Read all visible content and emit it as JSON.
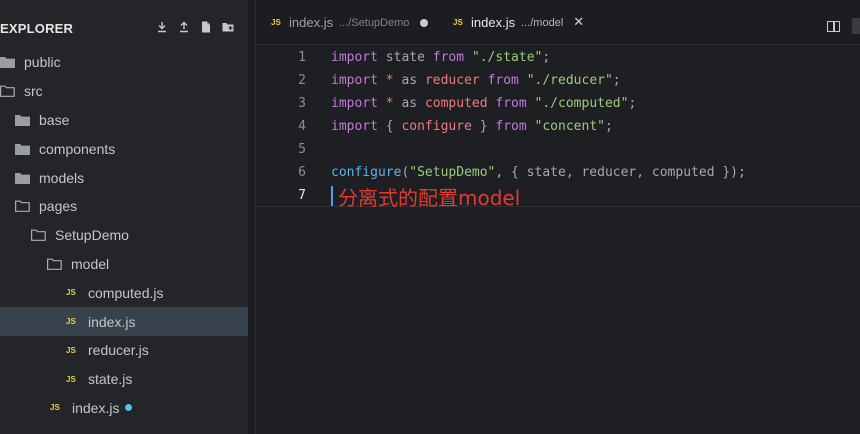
{
  "sidebar": {
    "title": "EXPLORER",
    "actions": [
      "download-icon",
      "upload-icon",
      "new-file-icon",
      "new-folder-icon"
    ],
    "tree": [
      {
        "label": "public",
        "type": "folder",
        "depth": 0
      },
      {
        "label": "src",
        "type": "folder-open",
        "depth": 0
      },
      {
        "label": "base",
        "type": "folder",
        "depth": 1
      },
      {
        "label": "components",
        "type": "folder",
        "depth": 1
      },
      {
        "label": "models",
        "type": "folder",
        "depth": 1
      },
      {
        "label": "pages",
        "type": "folder-open",
        "depth": 1
      },
      {
        "label": "SetupDemo",
        "type": "folder-open",
        "depth": 2
      },
      {
        "label": "model",
        "type": "folder-open",
        "depth": 3
      },
      {
        "label": "computed.js",
        "type": "js",
        "depth": 4
      },
      {
        "label": "index.js",
        "type": "js",
        "depth": 4,
        "selected": true
      },
      {
        "label": "reducer.js",
        "type": "js",
        "depth": 4
      },
      {
        "label": "state.js",
        "type": "js",
        "depth": 4
      },
      {
        "label": "index.js",
        "type": "js",
        "depth": 3,
        "modified": true
      }
    ]
  },
  "tabs": [
    {
      "badge": "JS",
      "name": "index.js",
      "path": ".../SetupDemo",
      "modified": true,
      "active": false
    },
    {
      "badge": "JS",
      "name": "index.js",
      "path": ".../model",
      "modified": false,
      "active": true
    }
  ],
  "editor": {
    "lines": [
      {
        "n": "1",
        "tokens": [
          [
            "kw",
            "import"
          ],
          [
            "id",
            " state "
          ],
          [
            "kw",
            "from"
          ],
          [
            "id",
            " "
          ],
          [
            "str",
            "\"./state\""
          ],
          [
            "punc",
            ";"
          ]
        ]
      },
      {
        "n": "2",
        "tokens": [
          [
            "kw",
            "import"
          ],
          [
            "id",
            " "
          ],
          [
            "ident",
            "*"
          ],
          [
            "id",
            " as "
          ],
          [
            "ident",
            "reducer"
          ],
          [
            "id",
            " "
          ],
          [
            "kw",
            "from"
          ],
          [
            "id",
            " "
          ],
          [
            "str",
            "\"./reducer\""
          ],
          [
            "punc",
            ";"
          ]
        ]
      },
      {
        "n": "3",
        "tokens": [
          [
            "kw",
            "import"
          ],
          [
            "id",
            " "
          ],
          [
            "ident",
            "*"
          ],
          [
            "id",
            " as "
          ],
          [
            "ident",
            "computed"
          ],
          [
            "id",
            " "
          ],
          [
            "kw",
            "from"
          ],
          [
            "id",
            " "
          ],
          [
            "str",
            "\"./computed\""
          ],
          [
            "punc",
            ";"
          ]
        ]
      },
      {
        "n": "4",
        "tokens": [
          [
            "kw",
            "import"
          ],
          [
            "id",
            " { "
          ],
          [
            "ident",
            "configure"
          ],
          [
            "id",
            " } "
          ],
          [
            "kw",
            "from"
          ],
          [
            "id",
            " "
          ],
          [
            "str",
            "\"concent\""
          ],
          [
            "punc",
            ";"
          ]
        ]
      },
      {
        "n": "5",
        "tokens": []
      },
      {
        "n": "6",
        "tokens": [
          [
            "fn",
            "configure"
          ],
          [
            "punc",
            "("
          ],
          [
            "str",
            "\"SetupDemo\""
          ],
          [
            "punc",
            ", { state, reducer, computed });"
          ]
        ]
      },
      {
        "n": "7",
        "tokens": [],
        "current": true
      }
    ],
    "annotation": "分离式的配置model"
  },
  "colors": {
    "accent": "#4c9eef",
    "js_badge": "#e8cc4c",
    "modified_dot": "#52c3ee",
    "annotation": "#e23a32"
  }
}
